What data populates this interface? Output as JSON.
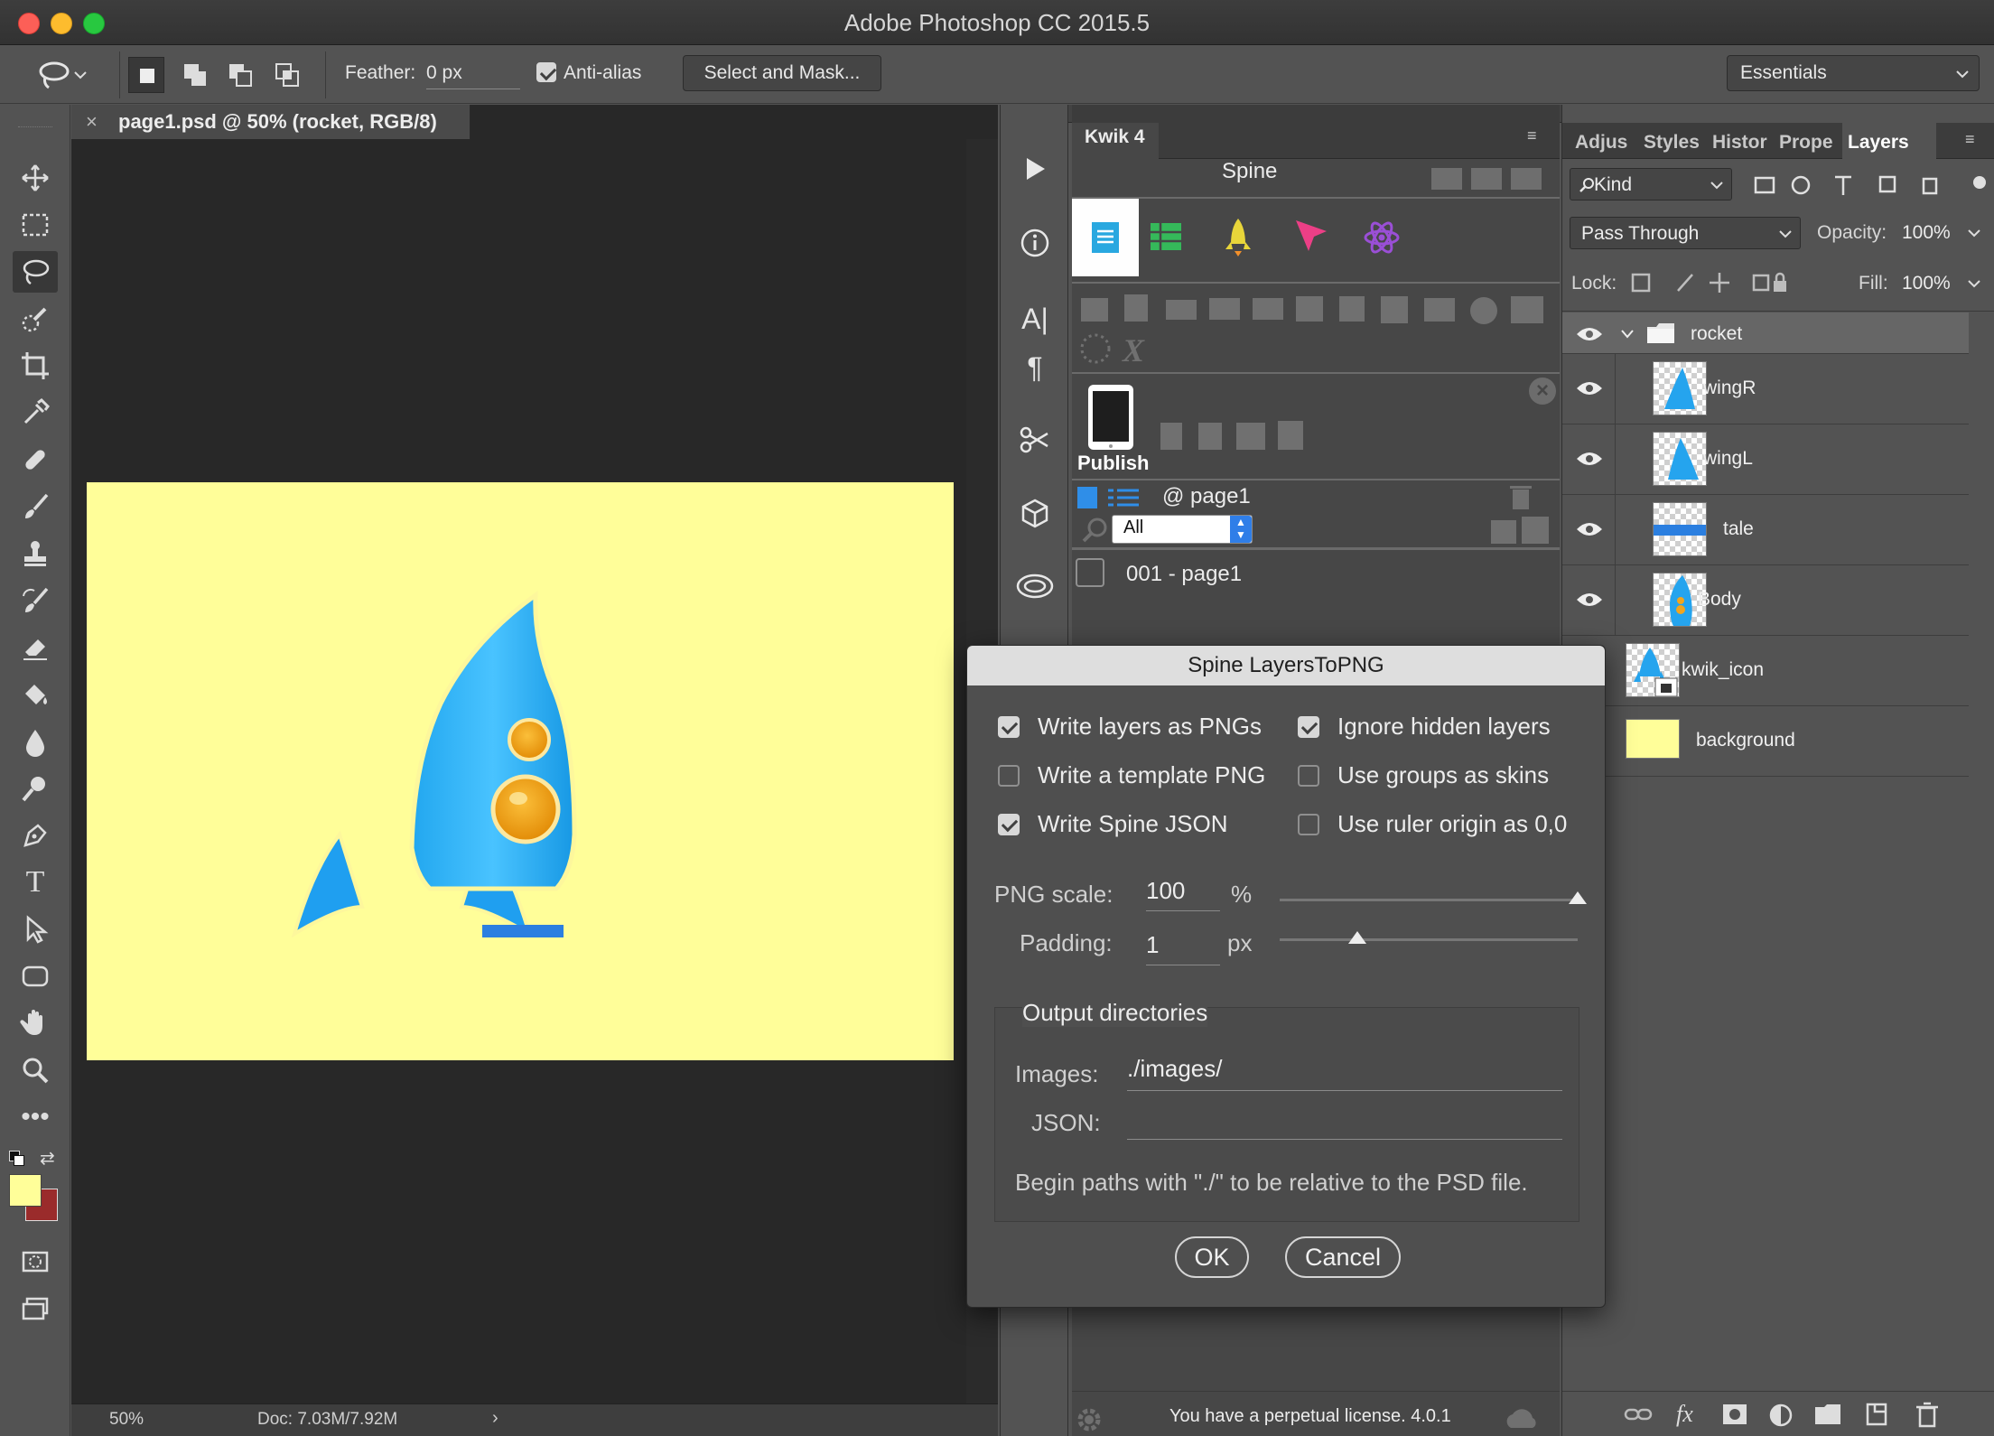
{
  "app": {
    "title": "Adobe Photoshop CC 2015.5"
  },
  "options": {
    "feather_label": "Feather:",
    "feather_value": "0 px",
    "antialias_label": "Anti-alias",
    "select_mask_label": "Select and Mask...",
    "workspace": "Essentials"
  },
  "document": {
    "tab_title": "page1.psd @ 50% (rocket, RGB/8)",
    "zoom": "50%",
    "doc_size": "Doc: 7.03M/7.92M",
    "canvas_color": "#fffe99"
  },
  "kwik": {
    "panel_tab": "Kwik 4",
    "spine_label": "Spine",
    "publish_label": "Publish",
    "page_label": "@ page1",
    "filter_value": "All",
    "page_item": "001 - page1",
    "license": "You have a perpetual license. 4.0.1"
  },
  "layers_panel": {
    "tabs": [
      "Adjust",
      "Styles",
      "Histor",
      "Prope",
      "Layers"
    ],
    "kind_label": "Kind",
    "blend_mode": "Pass Through",
    "opacity_label": "Opacity:",
    "opacity_value": "100%",
    "lock_label": "Lock:",
    "fill_label": "Fill:",
    "fill_value": "100%",
    "layers": [
      "rocket",
      "wingR",
      "wingL",
      "tale",
      "Body",
      "kwik_icon",
      "background"
    ]
  },
  "dialog": {
    "title": "Spine LayersToPNG",
    "options": [
      {
        "label": "Write layers as PNGs",
        "checked": true
      },
      {
        "label": "Ignore hidden layers",
        "checked": true
      },
      {
        "label": "Write a template PNG",
        "checked": false
      },
      {
        "label": "Use groups as skins",
        "checked": false
      },
      {
        "label": "Write Spine JSON",
        "checked": true
      },
      {
        "label": "Use ruler origin as 0,0",
        "checked": false
      }
    ],
    "png_scale_label": "PNG scale:",
    "png_scale_value": "100",
    "png_scale_unit": "%",
    "png_scale_slider": 1.0,
    "padding_label": "Padding:",
    "padding_value": "1",
    "padding_unit": "px",
    "padding_slider": 0.26,
    "output_group": "Output directories",
    "images_label": "Images:",
    "images_value": "./images/",
    "json_label": "JSON:",
    "json_value": "",
    "hint": "Begin paths with \"./\" to be relative to the PSD file.",
    "ok_label": "OK",
    "cancel_label": "Cancel"
  }
}
